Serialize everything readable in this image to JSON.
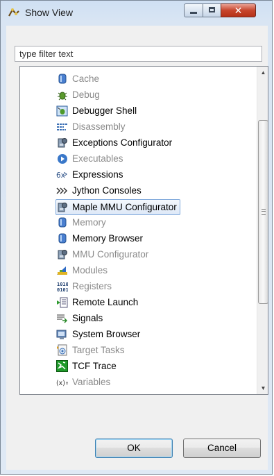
{
  "window": {
    "title": "Show View"
  },
  "filter": {
    "placeholder": "type filter text"
  },
  "views": [
    {
      "label": "Cache",
      "icon": "memory-cylinder-icon",
      "enabled": false
    },
    {
      "label": "Debug",
      "icon": "bug-icon",
      "enabled": false
    },
    {
      "label": "Debugger Shell",
      "icon": "debugger-shell-icon",
      "enabled": true
    },
    {
      "label": "Disassembly",
      "icon": "disassembly-icon",
      "enabled": false
    },
    {
      "label": "Exceptions Configurator",
      "icon": "configurator-icon",
      "enabled": true
    },
    {
      "label": "Executables",
      "icon": "play-circle-icon",
      "enabled": false
    },
    {
      "label": "Expressions",
      "icon": "expressions-icon",
      "enabled": true
    },
    {
      "label": "Jython Consoles",
      "icon": "jython-chevrons-icon",
      "enabled": true
    },
    {
      "label": "Maple MMU Configurator",
      "icon": "configurator-icon",
      "enabled": true,
      "selected": true
    },
    {
      "label": "Memory",
      "icon": "memory-cylinder-icon",
      "enabled": false
    },
    {
      "label": "Memory Browser",
      "icon": "memory-cylinder-icon",
      "enabled": true
    },
    {
      "label": "MMU Configurator",
      "icon": "configurator-icon",
      "enabled": false
    },
    {
      "label": "Modules",
      "icon": "modules-icon",
      "enabled": false
    },
    {
      "label": "Registers",
      "icon": "registers-binary-icon",
      "enabled": false
    },
    {
      "label": "Remote Launch",
      "icon": "remote-launch-icon",
      "enabled": true
    },
    {
      "label": "Signals",
      "icon": "signals-icon",
      "enabled": true
    },
    {
      "label": "System Browser",
      "icon": "system-browser-icon",
      "enabled": true
    },
    {
      "label": "Target Tasks",
      "icon": "target-tasks-icon",
      "enabled": false
    },
    {
      "label": "TCF Trace",
      "icon": "tcf-trace-icon",
      "enabled": true
    },
    {
      "label": "Variables",
      "icon": "variables-icon",
      "enabled": false
    }
  ],
  "buttons": {
    "ok": "OK",
    "cancel": "Cancel"
  },
  "colors": {
    "selection_border": "#84acdd",
    "disabled_text": "#8a8a8a",
    "close_button": "#c7452c"
  }
}
